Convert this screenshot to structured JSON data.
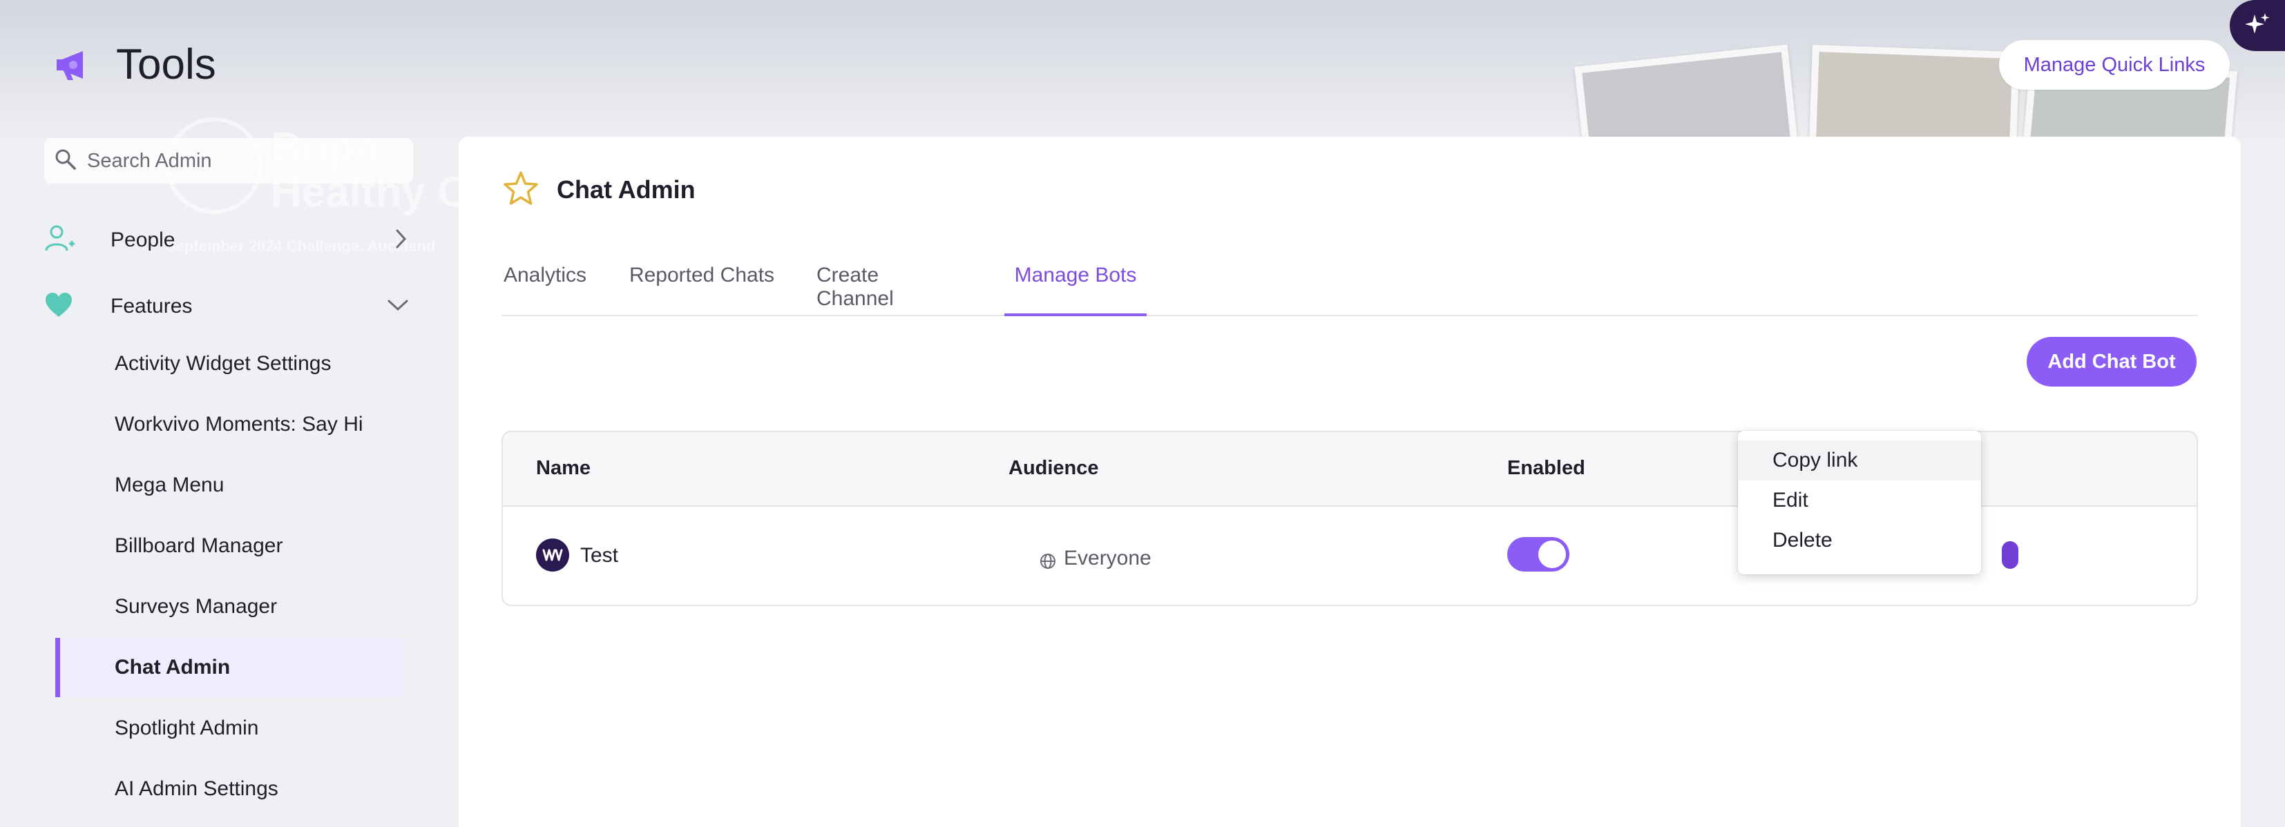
{
  "app": {
    "title": "Tools",
    "quick_links_label": "Manage Quick Links"
  },
  "background": {
    "brand_line1": "Bupa",
    "brand_line2": "Healthy C",
    "caption": "September 2024 Challenge. Auckland"
  },
  "sidebar": {
    "search_placeholder": "Search Admin",
    "people_label": "People",
    "features_label": "Features",
    "items": [
      {
        "label": "Activity Widget Settings"
      },
      {
        "label": "Workvivo Moments: Say Hi"
      },
      {
        "label": "Mega Menu"
      },
      {
        "label": "Billboard Manager"
      },
      {
        "label": "Surveys Manager"
      },
      {
        "label": "Chat Admin",
        "active": true
      },
      {
        "label": "Spotlight Admin"
      },
      {
        "label": "AI Admin Settings"
      }
    ]
  },
  "main": {
    "title": "Chat Admin",
    "tabs": [
      {
        "label": "Analytics"
      },
      {
        "label": "Reported Chats"
      },
      {
        "label": "Create Channel"
      },
      {
        "label": "Manage Bots",
        "active": true
      }
    ],
    "add_bot_label": "Add Chat Bot",
    "table": {
      "headers": [
        "Name",
        "Audience",
        "Enabled"
      ],
      "rows": [
        {
          "name": "Test",
          "audience": "Everyone",
          "enabled": true
        }
      ]
    },
    "context_menu": [
      "Copy link",
      "Edit",
      "Delete"
    ]
  },
  "colors": {
    "accent": "#8b5cf6",
    "accent_text": "#6c3fd6",
    "teal": "#5ac8b8"
  },
  "icons": [
    "megaphone-icon",
    "sparkle-icon",
    "search-icon",
    "add-person-icon",
    "heart-icon",
    "chevron-right-icon",
    "chevron-down-icon",
    "star-icon",
    "workvivo-logo-icon",
    "globe-icon"
  ]
}
